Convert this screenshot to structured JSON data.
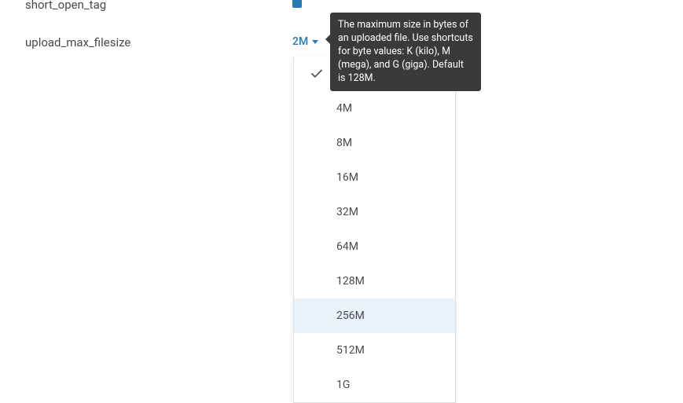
{
  "settings": {
    "short_open_tag": {
      "label": "short_open_tag"
    },
    "upload_max_filesize": {
      "label": "upload_max_filesize",
      "current_value": "2M"
    }
  },
  "tooltip": {
    "text": "The maximum size in bytes of an uploaded file. Use shortcuts for byte values: K (kilo), M (mega), and G (giga). Default is 128M."
  },
  "dropdown": {
    "options": [
      {
        "label": "2M",
        "selected": true,
        "hover": false
      },
      {
        "label": "4M",
        "selected": false,
        "hover": false
      },
      {
        "label": "8M",
        "selected": false,
        "hover": false
      },
      {
        "label": "16M",
        "selected": false,
        "hover": false
      },
      {
        "label": "32M",
        "selected": false,
        "hover": false
      },
      {
        "label": "64M",
        "selected": false,
        "hover": false
      },
      {
        "label": "128M",
        "selected": false,
        "hover": false
      },
      {
        "label": "256M",
        "selected": false,
        "hover": true
      },
      {
        "label": "512M",
        "selected": false,
        "hover": false
      },
      {
        "label": "1G",
        "selected": false,
        "hover": false
      }
    ]
  }
}
